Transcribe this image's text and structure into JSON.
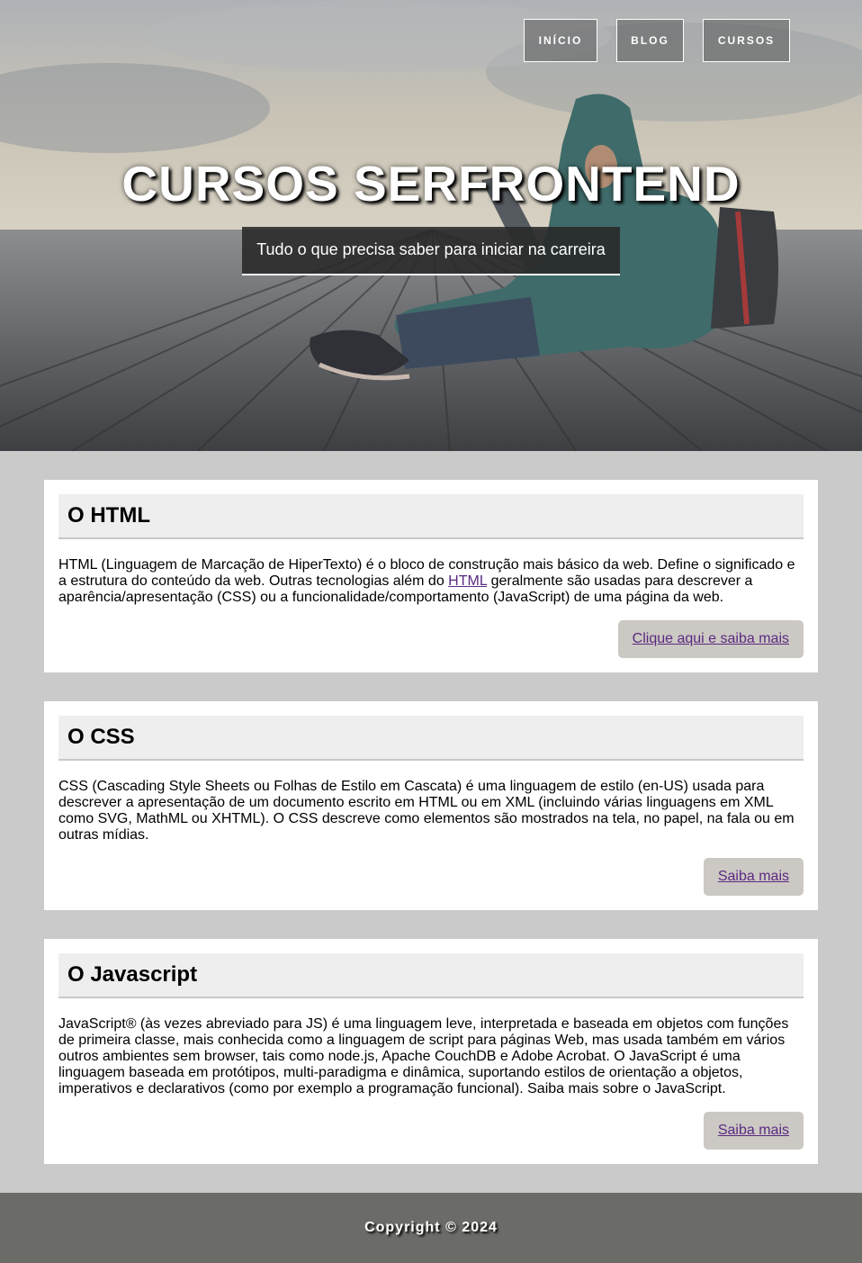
{
  "nav": {
    "items": [
      "INÍCIO",
      "BLOG",
      "CURSOS"
    ]
  },
  "hero": {
    "title": "CURSOS SERFRONTEND",
    "subtitle": "Tudo o que precisa saber para iniciar na carreira"
  },
  "cards": [
    {
      "title": "O HTML",
      "body_before": "HTML (Linguagem de Marcação de HiperTexto) é o bloco de construção mais básico da web. Define o significado e a estrutura do conteúdo da web. Outras tecnologias além do ",
      "body_link": "HTML",
      "body_after": " geralmente são usadas para descrever a aparência/apresentação (CSS) ou a funcionalidade/comportamento (JavaScript) de uma página da web.",
      "button": "Clique aqui e saiba mais"
    },
    {
      "title": "O CSS",
      "body": "CSS (Cascading Style Sheets ou Folhas de Estilo em Cascata) é uma linguagem de estilo (en-US) usada para descrever a apresentação de um documento escrito em HTML ou em XML (incluindo várias linguagens em XML como SVG, MathML ou XHTML). O CSS descreve como elementos são mostrados na tela, no papel, na fala ou em outras mídias.",
      "button": "Saiba mais"
    },
    {
      "title": "O Javascript",
      "body": "JavaScript® (às vezes abreviado para JS) é uma linguagem leve, interpretada e baseada em objetos com funções de primeira classe, mais conhecida como a linguagem de script para páginas Web, mas usada também em vários outros ambientes sem browser, tais como node.js, Apache CouchDB e Adobe Acrobat. O JavaScript é uma linguagem baseada em protótipos, multi-paradigma e dinâmica, suportando estilos de orientação a objetos, imperativos e declarativos (como por exemplo a programação funcional). Saiba mais sobre o JavaScript.",
      "button": "Saiba mais"
    }
  ],
  "footer": {
    "text": "Copyright © 2024"
  }
}
